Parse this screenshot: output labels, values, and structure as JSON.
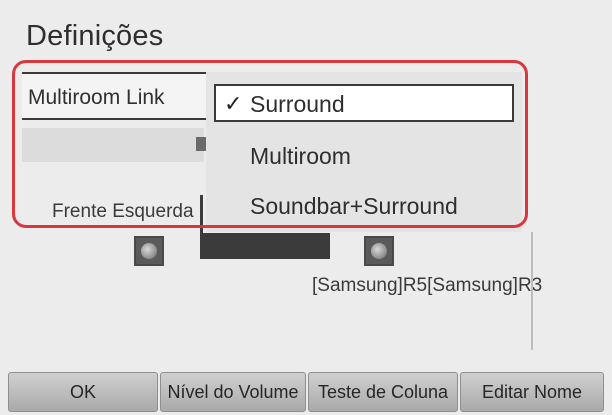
{
  "page": {
    "title": "Definições"
  },
  "setting": {
    "label": "Multiroom Link"
  },
  "dropdown": {
    "check_glyph": "✓",
    "options": [
      {
        "label": "Surround",
        "selected": true
      },
      {
        "label": "Multiroom",
        "selected": false
      },
      {
        "label": "Soundbar+Surround",
        "selected": false
      }
    ]
  },
  "speakers": {
    "left_label": "Frente Esquerda",
    "right_label": "[Samsung]R5[Samsung]R3",
    "icon": "speaker-icon"
  },
  "buttons": {
    "ok": "OK",
    "volume": "Nível do Volume",
    "test": "Teste de Coluna",
    "edit": "Editar Nome"
  },
  "colors": {
    "highlight": "#d9363e",
    "background": "#ececec",
    "selected_bg": "#ffffff"
  }
}
